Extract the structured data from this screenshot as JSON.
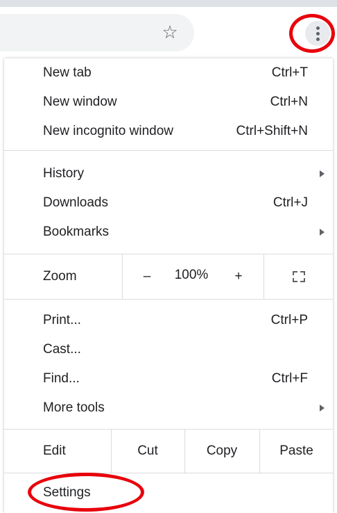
{
  "toolbar": {
    "bookmark_icon": "star-outline-icon",
    "menu_icon": "three-dots-vertical-icon"
  },
  "menu": {
    "group1": [
      {
        "label": "New tab",
        "shortcut": "Ctrl+T"
      },
      {
        "label": "New window",
        "shortcut": "Ctrl+N"
      },
      {
        "label": "New incognito window",
        "shortcut": "Ctrl+Shift+N"
      }
    ],
    "group2": [
      {
        "label": "History",
        "shortcut": ""
      },
      {
        "label": "Downloads",
        "shortcut": "Ctrl+J"
      },
      {
        "label": "Bookmarks",
        "shortcut": ""
      }
    ],
    "zoom": {
      "label": "Zoom",
      "minus": "–",
      "value": "100%",
      "plus": "+",
      "fullscreen_icon": "fullscreen-icon"
    },
    "group3": [
      {
        "label": "Print...",
        "shortcut": "Ctrl+P"
      },
      {
        "label": "Cast...",
        "shortcut": ""
      },
      {
        "label": "Find...",
        "shortcut": "Ctrl+F"
      },
      {
        "label": "More tools",
        "shortcut": ""
      }
    ],
    "edit": {
      "label": "Edit",
      "cut": "Cut",
      "copy": "Copy",
      "paste": "Paste"
    },
    "settings": {
      "label": "Settings"
    }
  },
  "colors": {
    "highlight": "#e8000b",
    "separator": "#dadce0",
    "text": "#202124"
  }
}
